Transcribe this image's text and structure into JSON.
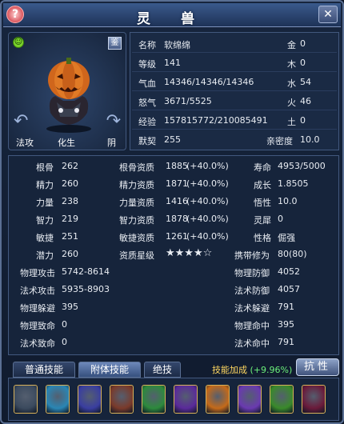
{
  "window": {
    "title": "灵 兽",
    "help_icon": "?",
    "close_icon": "✕"
  },
  "portrait": {
    "mood_icon": "smile-icon",
    "appraise_label": "鉴",
    "tags": [
      "法攻",
      "化生",
      "阴"
    ]
  },
  "info": {
    "name_label": "名称",
    "name": "软绵绵",
    "level_label": "等级",
    "level": "141",
    "hp_label": "气血",
    "hp": "14346/14346/14346",
    "rage_label": "怒气",
    "rage": "3671/5525",
    "exp_label": "经验",
    "exp": "157815772/210085491",
    "tacit_label": "默契",
    "tacit": "255",
    "metal_label": "金",
    "metal": "0",
    "wood_label": "木",
    "wood": "0",
    "water_label": "水",
    "water": "54",
    "fire_label": "火",
    "fire": "46",
    "earth_label": "土",
    "earth": "0",
    "intimacy_label": "亲密度",
    "intimacy": "10.0"
  },
  "stats": {
    "c1": [
      {
        "label": "根骨",
        "value": "262"
      },
      {
        "label": "精力",
        "value": "260"
      },
      {
        "label": "力量",
        "value": "238"
      },
      {
        "label": "智力",
        "value": "219"
      },
      {
        "label": "敏捷",
        "value": "251"
      },
      {
        "label": "潜力",
        "value": "260"
      }
    ],
    "c2": [
      {
        "label": "根骨资质",
        "value": "1885",
        "bonus": "(+40.0%)"
      },
      {
        "label": "精力资质",
        "value": "1871",
        "bonus": "(+40.0%)"
      },
      {
        "label": "力量资质",
        "value": "1416",
        "bonus": "(+40.0%)"
      },
      {
        "label": "智力资质",
        "value": "1878",
        "bonus": "(+40.0%)"
      },
      {
        "label": "敏捷资质",
        "value": "1261",
        "bonus": "(+40.0%)"
      },
      {
        "label": "资质星级",
        "value": "★★★★☆"
      }
    ],
    "c3": [
      {
        "label": "寿命",
        "value": "4953/5000"
      },
      {
        "label": "成长",
        "value": "1.8505"
      },
      {
        "label": "悟性",
        "value": "10.0"
      },
      {
        "label": "灵犀",
        "value": "0"
      },
      {
        "label": "性格",
        "value": "倔强"
      },
      {
        "label": "携带修为",
        "value": "80(80)"
      }
    ],
    "left_lower": [
      {
        "label": "物理攻击",
        "value": "5742-8614"
      },
      {
        "label": "法术攻击",
        "value": "5935-8903"
      },
      {
        "label": "物理躲避",
        "value": "395"
      },
      {
        "label": "物理致命",
        "value": "0"
      },
      {
        "label": "法术致命",
        "value": "0"
      }
    ],
    "right_lower": [
      {
        "label": "物理防御",
        "value": "4052"
      },
      {
        "label": "法术防御",
        "value": "4057"
      },
      {
        "label": "法术躲避",
        "value": "791"
      },
      {
        "label": "物理命中",
        "value": "395"
      },
      {
        "label": "法术命中",
        "value": "791"
      }
    ]
  },
  "tabs": [
    "普通技能",
    "附体技能",
    "绝技"
  ],
  "active_tab": "附体技能",
  "skill_bonus": {
    "label": "技能加成",
    "value": "(+9.96%)"
  },
  "resist_button": "抗性",
  "skills": [
    {
      "icon": "wolf-skill-icon",
      "color": "#3b4a5e"
    },
    {
      "icon": "feather-skill-icon",
      "color": "#2a86b4"
    },
    {
      "icon": "shield-skill-icon",
      "color": "#3a3ea0"
    },
    {
      "icon": "armor-skill-icon",
      "color": "#7a3a2a"
    },
    {
      "icon": "green-spirit-skill-icon",
      "color": "#2d8a3c"
    },
    {
      "icon": "spiral-skill-icon",
      "color": "#5a2a9a"
    },
    {
      "icon": "flame-skill-icon",
      "color": "#c46a1a"
    },
    {
      "icon": "vortex-skill-icon",
      "color": "#6a3ab0"
    },
    {
      "icon": "lock-skill-icon",
      "color": "#3a8a2a"
    },
    {
      "icon": "figure-skill-icon",
      "color": "#6a1a3a"
    }
  ]
}
